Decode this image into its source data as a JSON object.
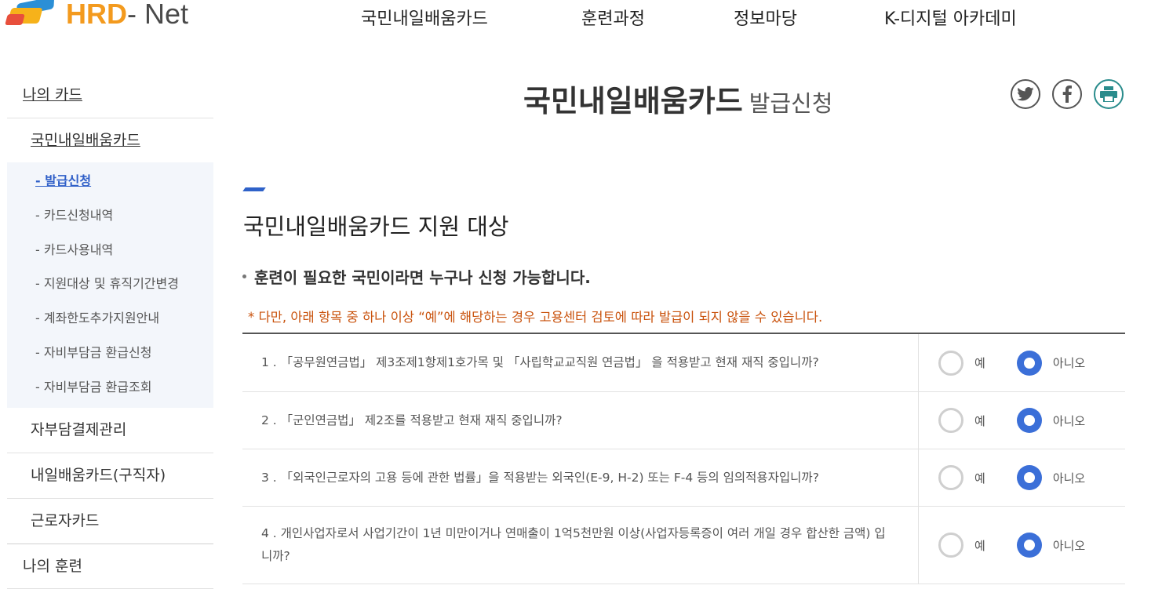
{
  "header": {
    "logo_text_a": "HRD",
    "logo_text_b": "- Net",
    "nav": [
      "국민내일배움카드",
      "훈련과정",
      "정보마당",
      "K-디지털 아카데미"
    ]
  },
  "sidebar": {
    "top": "나의 카드",
    "sub": "국민내일배움카드",
    "items": [
      "- 발급신청",
      "- 카드신청내역",
      "- 카드사용내역",
      "- 지원대상 및 휴직기간변경",
      "- 계좌한도추가지원안내",
      "- 자비부담금 환급신청",
      "- 자비부담금 환급조회"
    ],
    "groups": [
      "자부담결제관리",
      "내일배움카드(구직자)",
      "근로자카드"
    ],
    "top2": "나의 훈련"
  },
  "title": {
    "main": "국민내일배움카드",
    "sub": "발급신청"
  },
  "social": [
    "twitter-icon",
    "facebook-icon",
    "print-icon"
  ],
  "section": {
    "title": "국민내일배움카드 지원 대상",
    "bullet": "훈련이 필요한 국민이라면 누구나 신청 가능합니다.",
    "notice": "* 다만, 아래 항목 중 하나 이상 “예”에 해당하는 경우 고용센터 검토에 따라 발급이 되지 않을 수 있습니다."
  },
  "colors": {
    "accent": "#2f62c9",
    "notice": "#c9520c",
    "radio_selected": "#3b6fd8"
  },
  "questions": [
    {
      "text": "1 . 「공무원연금법」 제3조제1항제1호가목 및 「사립학교교직원 연금법」 을 적용받고 현재 재직 중입니까?",
      "yes": "예",
      "no": "아니오",
      "selected": "no"
    },
    {
      "text": "2 . 「군인연금법」 제2조를 적용받고 현재 재직 중입니까?",
      "yes": "예",
      "no": "아니오",
      "selected": "no"
    },
    {
      "text": "3 . 「외국인근로자의 고용 등에 관한 법률」을 적용받는 외국인(E-9, H-2) 또는 F-4 등의 임의적용자입니까?",
      "yes": "예",
      "no": "아니오",
      "selected": "no"
    },
    {
      "text": "4 . 개인사업자로서 사업기간이 1년 미만이거나 연매출이 1억5천만원 이상(사업자등록증이 여러 개일 경우 합산한 금액) 입니까?",
      "yes": "예",
      "no": "아니오",
      "selected": "no"
    }
  ]
}
